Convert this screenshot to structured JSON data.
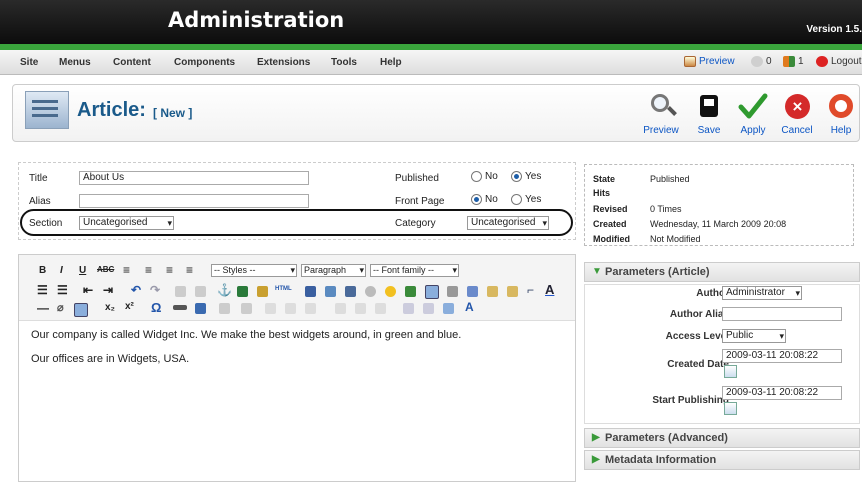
{
  "header": {
    "title": "Administration",
    "version": "Version 1.5."
  },
  "menu": [
    "Site",
    "Menus",
    "Content",
    "Components",
    "Extensions",
    "Tools",
    "Help"
  ],
  "status": {
    "preview": "Preview",
    "messages": "0",
    "users": "1",
    "logout": "Logout"
  },
  "toolbar": {
    "title": "Article:",
    "subtitle": "[ New ]",
    "buttons": [
      "Preview",
      "Save",
      "Apply",
      "Cancel",
      "Help"
    ]
  },
  "form": {
    "title_label": "Title",
    "title_value": "About Us",
    "alias_label": "Alias",
    "alias_value": "",
    "section_label": "Section",
    "section_value": "Uncategorised",
    "published_label": "Published",
    "frontpage_label": "Front Page",
    "no": "No",
    "yes": "Yes",
    "category_label": "Category",
    "category_value": "Uncategorised"
  },
  "info": {
    "state_label": "State",
    "state_value": "Published",
    "hits_label": "Hits",
    "hits_value": "",
    "revised_label": "Revised",
    "revised_value": "0 Times",
    "created_label": "Created",
    "created_value": "Wednesday, 11 March 2009 20:08",
    "modified_label": "Modified",
    "modified_value": "Not Modified"
  },
  "editor": {
    "styles": "-- Styles --",
    "format": "Paragraph",
    "font": "-- Font family --",
    "line1": "Our company is called Widget Inc.  We make the best widgets around, in green and blue.",
    "line2": "Our offices are in Widgets, USA."
  },
  "params": {
    "title": "Parameters (Article)",
    "author_label": "Author",
    "author_value": "Administrator",
    "alias_label": "Author Alias",
    "alias_value": "",
    "access_label": "Access Level",
    "access_value": "Public",
    "created_label": "Created Date",
    "created_value": "2009-03-11 20:08:22",
    "start_label": "Start Publishing",
    "start_value": "2009-03-11 20:08:22"
  },
  "panels": {
    "advanced": "Parameters (Advanced)",
    "metadata": "Metadata Information"
  }
}
